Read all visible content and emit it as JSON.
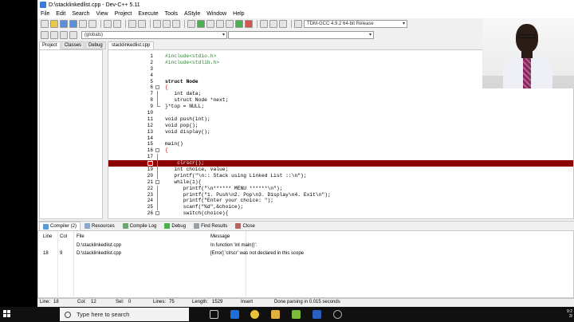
{
  "window": {
    "title": "D:\\stacklinkedlist.cpp - Dev-C++ 5.11"
  },
  "menu": [
    "File",
    "Edit",
    "Search",
    "View",
    "Project",
    "Execute",
    "Tools",
    "AStyle",
    "Window",
    "Help"
  ],
  "toolbar": {
    "compiler": "TDM-GCC 4.9.2 64-bit Release",
    "scope": "(globals)"
  },
  "left_tabs": [
    "Project",
    "Classes",
    "Debug"
  ],
  "file_tab": "stacklinkedlist.cpp",
  "code": [
    {
      "n": "1",
      "t": "#include<stdio.h>",
      "c": "pp",
      "f": ""
    },
    {
      "n": "2",
      "t": "#include<stdlib.h>",
      "c": "pp",
      "f": ""
    },
    {
      "n": "3",
      "t": "",
      "c": "",
      "f": ""
    },
    {
      "n": "4",
      "t": "",
      "c": "",
      "f": ""
    },
    {
      "n": "5",
      "t": "struct Node",
      "c": "kw",
      "f": ""
    },
    {
      "n": "6",
      "t": "{",
      "c": "sym",
      "f": "box"
    },
    {
      "n": "7",
      "t": "   int data;",
      "c": "",
      "f": "bar"
    },
    {
      "n": "8",
      "t": "   struct Node *next;",
      "c": "",
      "f": "bar"
    },
    {
      "n": "9",
      "t": "}*top = NULL;",
      "c": "",
      "f": "end"
    },
    {
      "n": "10",
      "t": "",
      "c": "",
      "f": ""
    },
    {
      "n": "11",
      "t": "void push(int);",
      "c": "",
      "f": ""
    },
    {
      "n": "12",
      "t": "void pop();",
      "c": "",
      "f": ""
    },
    {
      "n": "13",
      "t": "void display();",
      "c": "",
      "f": ""
    },
    {
      "n": "14",
      "t": "",
      "c": "",
      "f": ""
    },
    {
      "n": "15",
      "t": "main()",
      "c": "",
      "f": ""
    },
    {
      "n": "16",
      "t": "{",
      "c": "sym",
      "f": "box"
    },
    {
      "n": "17",
      "t": "",
      "c": "",
      "f": "bar"
    },
    {
      "n": "18",
      "t": "    clrscr();",
      "c": "",
      "f": "bar",
      "err": true
    },
    {
      "n": "19",
      "t": "   int choice, value;",
      "c": "",
      "f": "bar"
    },
    {
      "n": "20",
      "t": "   printf(\"\\n:: Stack using Linked List ::\\n\");",
      "c": "",
      "f": "bar"
    },
    {
      "n": "21",
      "t": "   while(1){",
      "c": "",
      "f": "box"
    },
    {
      "n": "22",
      "t": "      printf(\"\\n****** MENU ******\\n\");",
      "c": "",
      "f": "bar"
    },
    {
      "n": "23",
      "t": "      printf(\"1. Push\\n2. Pop\\n3. Display\\n4. Exit\\n\");",
      "c": "",
      "f": "bar"
    },
    {
      "n": "24",
      "t": "      printf(\"Enter your choice: \");",
      "c": "",
      "f": "bar"
    },
    {
      "n": "25",
      "t": "      scanf(\"%d\",&choice);",
      "c": "",
      "f": "bar"
    },
    {
      "n": "26",
      "t": "      switch(choice){",
      "c": "",
      "f": "box"
    }
  ],
  "bottom_tabs": [
    "Compiler (2)",
    "Resources",
    "Compile Log",
    "Debug",
    "Find Results",
    "Close"
  ],
  "output": {
    "headers": [
      "Line",
      "Col",
      "File",
      "Message"
    ],
    "rows": [
      {
        "line": "",
        "col": "",
        "file": "D:\\stacklinkedlist.cpp",
        "msg": "In function 'int main()':"
      },
      {
        "line": "18",
        "col": "9",
        "file": "D:\\stacklinkedlist.cpp",
        "msg": "[Error] 'clrscr' was not declared in this scope"
      }
    ]
  },
  "status": {
    "line": "Line:",
    "line_v": "18",
    "col": "Col:",
    "col_v": "12",
    "sel": "Sel:",
    "sel_v": "0",
    "lines": "Lines:",
    "lines_v": "75",
    "length": "Length:",
    "length_v": "1529",
    "mode": "Insert",
    "msg": "Done parsing in 0.015 seconds"
  },
  "taskbar": {
    "search_placeholder": "Type here to search",
    "time": "9:2",
    "date": "3/"
  }
}
